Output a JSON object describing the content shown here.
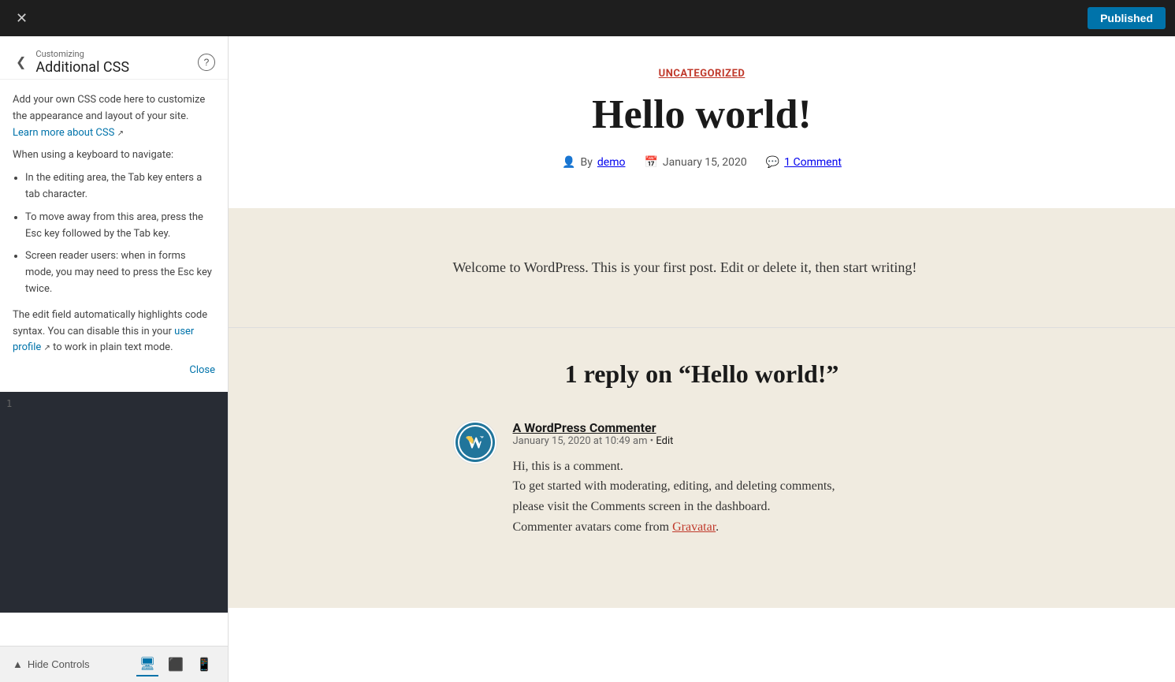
{
  "topbar": {
    "close_label": "✕",
    "published_label": "Published"
  },
  "sidebar": {
    "customizing_label": "Customizing",
    "title": "Additional CSS",
    "help_label": "?",
    "description": "Add your own CSS code here to customize the appearance and layout of your site.",
    "learn_more_text": "Learn more about CSS",
    "keyboard_nav_label": "When using a keyboard to navigate:",
    "keyboard_tips": [
      "In the editing area, the Tab key enters a tab character.",
      "To move away from this area, press the Esc key followed by the Tab key.",
      "Screen reader users: when in forms mode, you may need to press the Esc key twice."
    ],
    "edit_field_note": "The edit field automatically highlights code syntax. You can disable this in your",
    "user_profile_text": "user profile",
    "plain_text_note": "to work in plain text mode.",
    "close_text": "Close",
    "line_number": "1"
  },
  "bottombar": {
    "hide_controls_label": "Hide Controls",
    "device_desktop_label": "🖥",
    "device_tablet_label": "⬜",
    "device_mobile_label": "📱"
  },
  "post": {
    "category": "UNCATEGORIZED",
    "title": "Hello world!",
    "meta": {
      "author_label": "By",
      "author": "demo",
      "date": "January 15, 2020",
      "comments": "1 Comment"
    },
    "body": "Welcome to WordPress. This is your first post. Edit or delete it, then start writing!",
    "replies_title": "1 reply on “Hello world!”",
    "comment": {
      "author": "A WordPress Commenter",
      "date": "January 15, 2020 at 10:49 am",
      "edit_label": "Edit",
      "text_line1": "Hi, this is a comment.",
      "text_line2": "To get started with moderating, editing, and deleting comments,",
      "text_line3": "please visit the Comments screen in the dashboard.",
      "text_line4": "Commenter avatars come from",
      "gravatar_text": "Gravatar",
      "text_end": "."
    }
  }
}
